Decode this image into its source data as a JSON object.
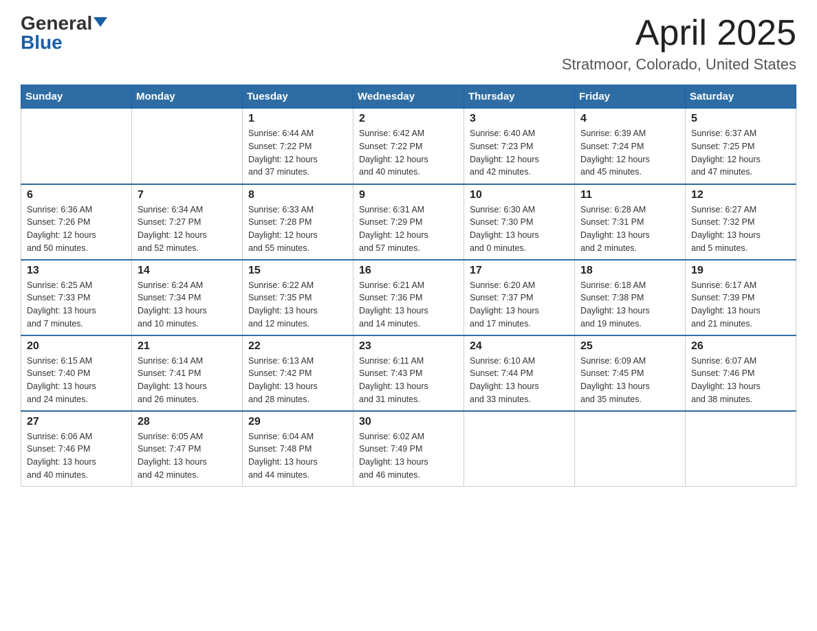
{
  "header": {
    "logo_general": "General",
    "logo_blue": "Blue",
    "month_title": "April 2025",
    "location": "Stratmoor, Colorado, United States"
  },
  "weekdays": [
    "Sunday",
    "Monday",
    "Tuesday",
    "Wednesday",
    "Thursday",
    "Friday",
    "Saturday"
  ],
  "weeks": [
    [
      {
        "day": "",
        "sunrise": "",
        "sunset": "",
        "daylight": ""
      },
      {
        "day": "",
        "sunrise": "",
        "sunset": "",
        "daylight": ""
      },
      {
        "day": "1",
        "sunrise": "Sunrise: 6:44 AM",
        "sunset": "Sunset: 7:22 PM",
        "daylight": "Daylight: 12 hours and 37 minutes."
      },
      {
        "day": "2",
        "sunrise": "Sunrise: 6:42 AM",
        "sunset": "Sunset: 7:22 PM",
        "daylight": "Daylight: 12 hours and 40 minutes."
      },
      {
        "day": "3",
        "sunrise": "Sunrise: 6:40 AM",
        "sunset": "Sunset: 7:23 PM",
        "daylight": "Daylight: 12 hours and 42 minutes."
      },
      {
        "day": "4",
        "sunrise": "Sunrise: 6:39 AM",
        "sunset": "Sunset: 7:24 PM",
        "daylight": "Daylight: 12 hours and 45 minutes."
      },
      {
        "day": "5",
        "sunrise": "Sunrise: 6:37 AM",
        "sunset": "Sunset: 7:25 PM",
        "daylight": "Daylight: 12 hours and 47 minutes."
      }
    ],
    [
      {
        "day": "6",
        "sunrise": "Sunrise: 6:36 AM",
        "sunset": "Sunset: 7:26 PM",
        "daylight": "Daylight: 12 hours and 50 minutes."
      },
      {
        "day": "7",
        "sunrise": "Sunrise: 6:34 AM",
        "sunset": "Sunset: 7:27 PM",
        "daylight": "Daylight: 12 hours and 52 minutes."
      },
      {
        "day": "8",
        "sunrise": "Sunrise: 6:33 AM",
        "sunset": "Sunset: 7:28 PM",
        "daylight": "Daylight: 12 hours and 55 minutes."
      },
      {
        "day": "9",
        "sunrise": "Sunrise: 6:31 AM",
        "sunset": "Sunset: 7:29 PM",
        "daylight": "Daylight: 12 hours and 57 minutes."
      },
      {
        "day": "10",
        "sunrise": "Sunrise: 6:30 AM",
        "sunset": "Sunset: 7:30 PM",
        "daylight": "Daylight: 13 hours and 0 minutes."
      },
      {
        "day": "11",
        "sunrise": "Sunrise: 6:28 AM",
        "sunset": "Sunset: 7:31 PM",
        "daylight": "Daylight: 13 hours and 2 minutes."
      },
      {
        "day": "12",
        "sunrise": "Sunrise: 6:27 AM",
        "sunset": "Sunset: 7:32 PM",
        "daylight": "Daylight: 13 hours and 5 minutes."
      }
    ],
    [
      {
        "day": "13",
        "sunrise": "Sunrise: 6:25 AM",
        "sunset": "Sunset: 7:33 PM",
        "daylight": "Daylight: 13 hours and 7 minutes."
      },
      {
        "day": "14",
        "sunrise": "Sunrise: 6:24 AM",
        "sunset": "Sunset: 7:34 PM",
        "daylight": "Daylight: 13 hours and 10 minutes."
      },
      {
        "day": "15",
        "sunrise": "Sunrise: 6:22 AM",
        "sunset": "Sunset: 7:35 PM",
        "daylight": "Daylight: 13 hours and 12 minutes."
      },
      {
        "day": "16",
        "sunrise": "Sunrise: 6:21 AM",
        "sunset": "Sunset: 7:36 PM",
        "daylight": "Daylight: 13 hours and 14 minutes."
      },
      {
        "day": "17",
        "sunrise": "Sunrise: 6:20 AM",
        "sunset": "Sunset: 7:37 PM",
        "daylight": "Daylight: 13 hours and 17 minutes."
      },
      {
        "day": "18",
        "sunrise": "Sunrise: 6:18 AM",
        "sunset": "Sunset: 7:38 PM",
        "daylight": "Daylight: 13 hours and 19 minutes."
      },
      {
        "day": "19",
        "sunrise": "Sunrise: 6:17 AM",
        "sunset": "Sunset: 7:39 PM",
        "daylight": "Daylight: 13 hours and 21 minutes."
      }
    ],
    [
      {
        "day": "20",
        "sunrise": "Sunrise: 6:15 AM",
        "sunset": "Sunset: 7:40 PM",
        "daylight": "Daylight: 13 hours and 24 minutes."
      },
      {
        "day": "21",
        "sunrise": "Sunrise: 6:14 AM",
        "sunset": "Sunset: 7:41 PM",
        "daylight": "Daylight: 13 hours and 26 minutes."
      },
      {
        "day": "22",
        "sunrise": "Sunrise: 6:13 AM",
        "sunset": "Sunset: 7:42 PM",
        "daylight": "Daylight: 13 hours and 28 minutes."
      },
      {
        "day": "23",
        "sunrise": "Sunrise: 6:11 AM",
        "sunset": "Sunset: 7:43 PM",
        "daylight": "Daylight: 13 hours and 31 minutes."
      },
      {
        "day": "24",
        "sunrise": "Sunrise: 6:10 AM",
        "sunset": "Sunset: 7:44 PM",
        "daylight": "Daylight: 13 hours and 33 minutes."
      },
      {
        "day": "25",
        "sunrise": "Sunrise: 6:09 AM",
        "sunset": "Sunset: 7:45 PM",
        "daylight": "Daylight: 13 hours and 35 minutes."
      },
      {
        "day": "26",
        "sunrise": "Sunrise: 6:07 AM",
        "sunset": "Sunset: 7:46 PM",
        "daylight": "Daylight: 13 hours and 38 minutes."
      }
    ],
    [
      {
        "day": "27",
        "sunrise": "Sunrise: 6:06 AM",
        "sunset": "Sunset: 7:46 PM",
        "daylight": "Daylight: 13 hours and 40 minutes."
      },
      {
        "day": "28",
        "sunrise": "Sunrise: 6:05 AM",
        "sunset": "Sunset: 7:47 PM",
        "daylight": "Daylight: 13 hours and 42 minutes."
      },
      {
        "day": "29",
        "sunrise": "Sunrise: 6:04 AM",
        "sunset": "Sunset: 7:48 PM",
        "daylight": "Daylight: 13 hours and 44 minutes."
      },
      {
        "day": "30",
        "sunrise": "Sunrise: 6:02 AM",
        "sunset": "Sunset: 7:49 PM",
        "daylight": "Daylight: 13 hours and 46 minutes."
      },
      {
        "day": "",
        "sunrise": "",
        "sunset": "",
        "daylight": ""
      },
      {
        "day": "",
        "sunrise": "",
        "sunset": "",
        "daylight": ""
      },
      {
        "day": "",
        "sunrise": "",
        "sunset": "",
        "daylight": ""
      }
    ]
  ]
}
